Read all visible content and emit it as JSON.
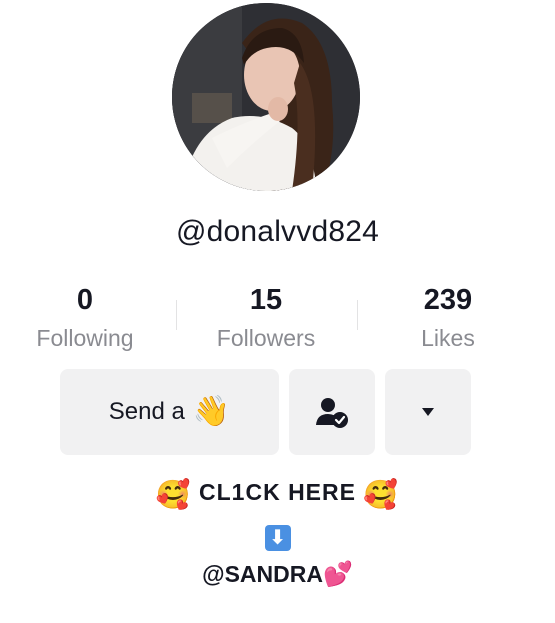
{
  "profile": {
    "username": "@donalvvd824",
    "avatar_icon": "profile-photo"
  },
  "stats": [
    {
      "value": "0",
      "label": "Following"
    },
    {
      "value": "15",
      "label": "Followers"
    },
    {
      "value": "239",
      "label": "Likes"
    }
  ],
  "actions": {
    "send_label": "Send a",
    "send_emoji": "👋",
    "friend_icon": "person-check-icon",
    "more_icon": "caret-down-icon"
  },
  "bio": {
    "line1_prefix_emoji": "🥰",
    "line1_text": "CL1CK HERE",
    "line1_suffix_emoji": "🥰",
    "line2_emoji": "⬇",
    "line3_text": "@SANDRA",
    "line3_emoji": "💕"
  },
  "colors": {
    "text": "#161823",
    "muted": "#8a8b91",
    "button_bg": "#f1f1f2"
  }
}
